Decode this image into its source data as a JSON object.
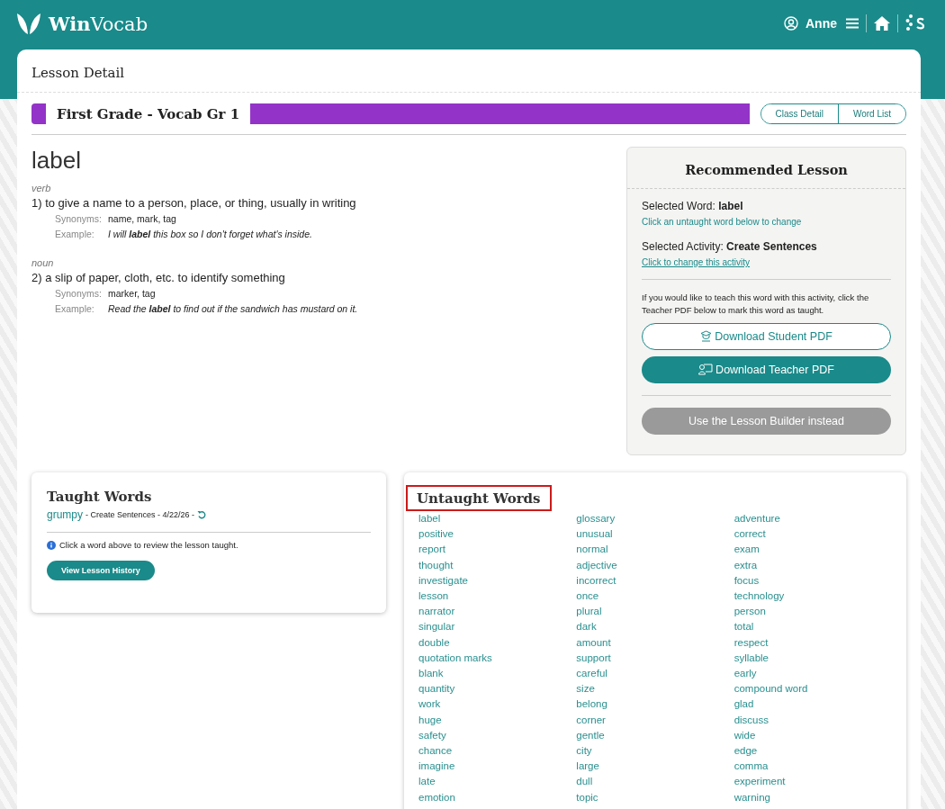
{
  "header": {
    "logo_bold": "Win",
    "logo_light": "Vocab",
    "user": "Anne"
  },
  "page_title": "Lesson Detail",
  "class_bar": {
    "title": "First Grade - Vocab Gr 1",
    "color": "#9333c8",
    "buttons": [
      "Class Detail",
      "Word List"
    ]
  },
  "word": {
    "headword": "label",
    "senses": [
      {
        "pos": "verb",
        "definition": "1) to give a name to a person, place, or thing, usually in writing",
        "synonyms_label": "Synonyms:",
        "synonyms": "name, mark, tag",
        "example_label": "Example:",
        "example": "I will **label** this box so I don't forget what's inside."
      },
      {
        "pos": "noun",
        "definition": "2) a slip of paper, cloth, etc. to identify something",
        "synonyms_label": "Synonyms:",
        "synonyms": "marker, tag",
        "example_label": "Example:",
        "example": "Read the **label** to find out if the sandwich has mustard on it."
      }
    ]
  },
  "recommended": {
    "title": "Recommended Lesson",
    "selected_word": "Selected Word: **label**",
    "word_link": "Click an untaught word below to change",
    "selected_activity": "Selected Activity: **Create Sentences**",
    "activity_link": "Click to change this activity",
    "note": "If you would like to teach this word with this activity, click the Teacher PDF below to mark this word as taught.",
    "student_button": "Download Student PDF",
    "teacher_button": "Download Teacher PDF",
    "builder_button": "Use the Lesson Builder instead",
    "builder_disabled": true
  },
  "taught": {
    "title": "Taught Words",
    "items": [
      {
        "word": "grumpy",
        "detail": "- Create Sentences - 4/22/26 -"
      }
    ],
    "hint": "Click a word above to review the lesson taught.",
    "button": "View Lesson History"
  },
  "untaught": {
    "title": "Untaught Words",
    "highlighted": true,
    "columns": [
      [
        "label",
        "positive",
        "report",
        "thought",
        "investigate",
        "lesson",
        "narrator",
        "singular",
        "double",
        "quotation marks",
        "blank",
        "quantity",
        "work",
        "huge",
        "safety",
        "chance",
        "imagine",
        "late",
        "emotion"
      ],
      [
        "glossary",
        "unusual",
        "normal",
        "adjective",
        "incorrect",
        "once",
        "plural",
        "dark",
        "amount",
        "support",
        "careful",
        "size",
        "belong",
        "corner",
        "gentle",
        "city",
        "large",
        "dull",
        "topic"
      ],
      [
        "adventure",
        "correct",
        "exam",
        "extra",
        "focus",
        "technology",
        "person",
        "total",
        "respect",
        "syllable",
        "early",
        "compound word",
        "glad",
        "discuss",
        "wide",
        "edge",
        "comma",
        "experiment",
        "warning"
      ]
    ]
  }
}
